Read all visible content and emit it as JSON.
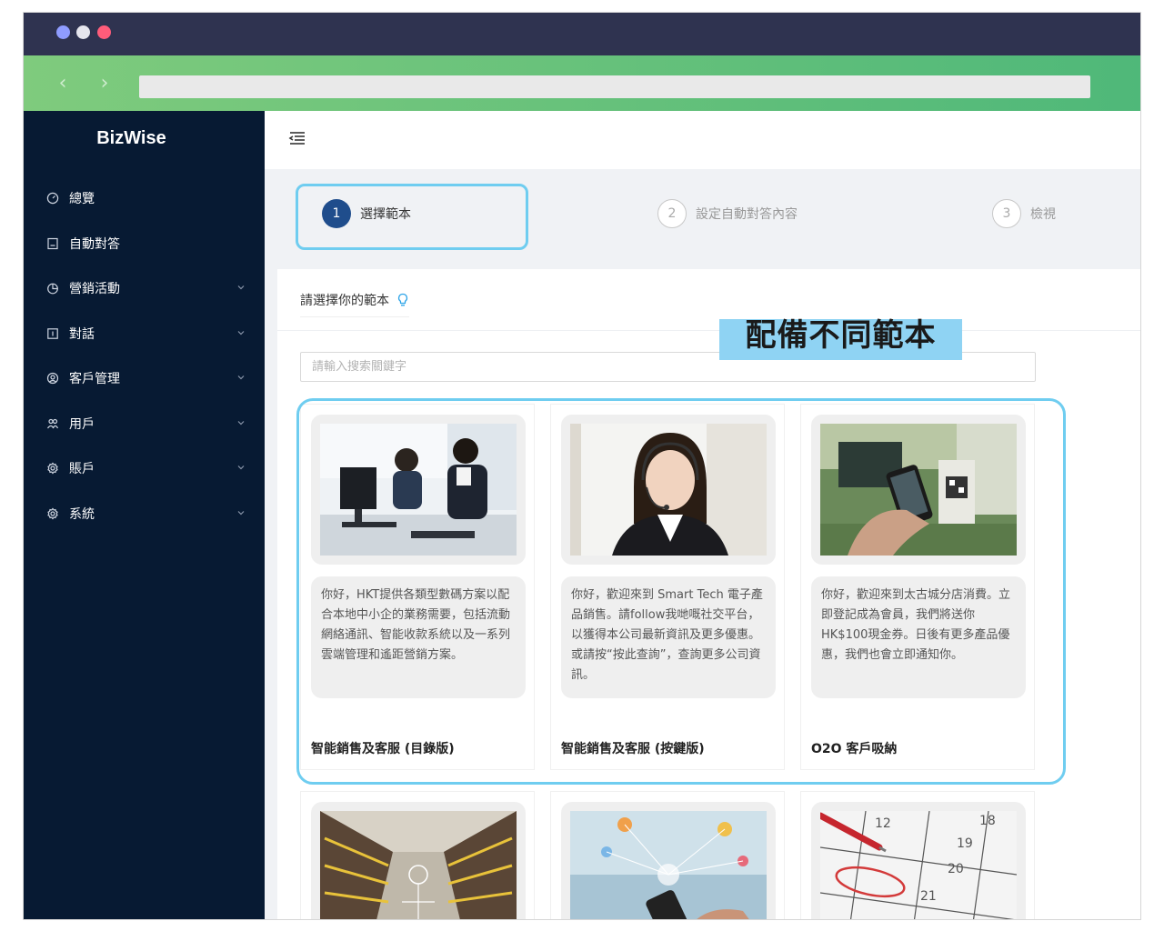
{
  "app": {
    "brand": "BizWise"
  },
  "sidebar": {
    "items": [
      {
        "label": "總覽",
        "icon": "dashboard-icon",
        "expandable": false
      },
      {
        "label": "自動對答",
        "icon": "auto-reply-icon",
        "expandable": false
      },
      {
        "label": "營銷活動",
        "icon": "pie-chart-icon",
        "expandable": true
      },
      {
        "label": "對話",
        "icon": "message-box-icon",
        "expandable": true
      },
      {
        "label": "客戶管理",
        "icon": "customer-icon",
        "expandable": true
      },
      {
        "label": "用戶",
        "icon": "users-icon",
        "expandable": true
      },
      {
        "label": "賬戶",
        "icon": "settings-icon",
        "expandable": true
      },
      {
        "label": "系統",
        "icon": "system-gear-icon",
        "expandable": true
      }
    ]
  },
  "steps": [
    {
      "num": "1",
      "label": "選擇範本",
      "active": true
    },
    {
      "num": "2",
      "label": "設定自動對答內容",
      "active": false
    },
    {
      "num": "3",
      "label": "檢視",
      "active": false
    }
  ],
  "panel": {
    "title": "請選擇你的範本",
    "search_placeholder": "請輸入搜索關鍵字",
    "callout": "配備不同範本"
  },
  "templates": [
    {
      "title": "智能銷售及客服 (目錄版)",
      "message": "你好，HKT提供各類型數碼方案以配合本地中小企的業務需要，包括流動網絡通訊、智能收款系統以及一系列雲端管理和遙距營銷方案。",
      "image": "call-center-team-photo"
    },
    {
      "title": "智能銷售及客服 (按鍵版)",
      "message": "你好，歡迎來到 Smart Tech 電子產品銷售。請follow我哋嘅社交平台，以獲得本公司最新資訊及更多優惠。或請按“按此查詢”，查詢更多公司資訊。",
      "image": "customer-service-agent-photo"
    },
    {
      "title": "O2O 客戶吸納",
      "message": "你好，歡迎來到太古城分店消費。立即登記成為會員，我們將送你HK$100現金券。日後有更多產品優惠，我們也會立即通知你。",
      "image": "qr-code-scan-photo"
    }
  ],
  "templates_row2": [
    {
      "image": "supermarket-aisle-photo"
    },
    {
      "image": "smartphone-network-photo"
    },
    {
      "image": "calendar-event-photo"
    }
  ]
}
